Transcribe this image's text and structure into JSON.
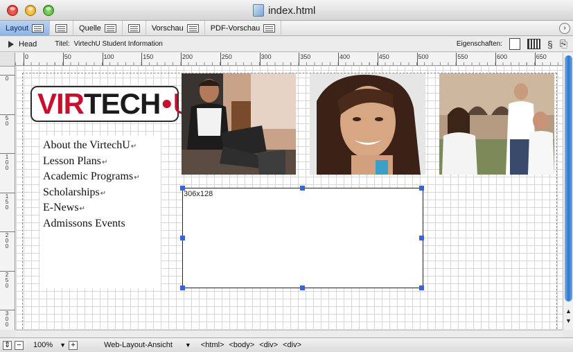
{
  "window": {
    "title": "index.html"
  },
  "modes": [
    {
      "label": "Layout",
      "active": true
    },
    {
      "label": "",
      "active": false
    },
    {
      "label": "Quelle",
      "active": false
    },
    {
      "label": "",
      "active": false
    },
    {
      "label": "Vorschau",
      "active": false
    },
    {
      "label": "PDF-Vorschau",
      "active": false
    }
  ],
  "headbar": {
    "head_label": "Head",
    "titel_label": "Titel:",
    "titel_value": "VirtechU Student Information",
    "props_label": "Eigenschaften:"
  },
  "ruler": {
    "h_labels": [
      "0",
      "50",
      "100",
      "150",
      "200",
      "250",
      "300",
      "350",
      "400",
      "450",
      "500",
      "550",
      "600",
      "650"
    ],
    "v_labels": [
      "0",
      "50",
      "100",
      "150",
      "200",
      "250",
      "300"
    ]
  },
  "logo": {
    "text_red": "VIR",
    "text_black": "TECH",
    "dot": "•",
    "u": "U"
  },
  "nav": {
    "items": [
      {
        "label": "About the VirtechU",
        "ret": "↵"
      },
      {
        "label": "Lesson Plans",
        "ret": "↵"
      },
      {
        "label": "Academic Programs",
        "ret": "↵"
      },
      {
        "label": "Scholarships",
        "ret": "↵"
      },
      {
        "label": "E-News",
        "ret": "↵"
      },
      {
        "label": "Admissons Events",
        "ret": ""
      }
    ]
  },
  "placeholder": {
    "label": "306x128"
  },
  "statusbar": {
    "zoom": "100%",
    "view": "Web-Layout-Ansicht",
    "path": [
      "<html>",
      "<body>",
      "<div>",
      "<div>"
    ]
  },
  "icons": {
    "close": "close-button-icon",
    "minimize": "minimize-button-icon",
    "zoom": "zoom-button-icon"
  }
}
